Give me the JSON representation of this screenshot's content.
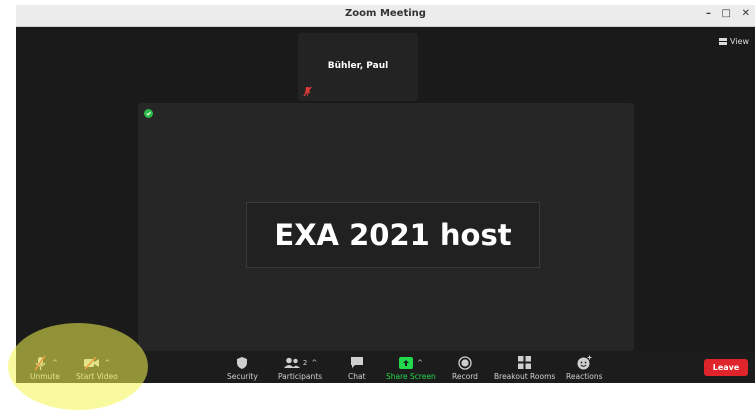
{
  "window": {
    "title": "Zoom Meeting",
    "minimize": "–",
    "maximize": "□",
    "close": "✕"
  },
  "view_button": {
    "label": "View"
  },
  "participant_tile": {
    "name": "Bühler, Paul"
  },
  "main_video": {
    "text": "EXA 2021 host"
  },
  "toolbar": {
    "unmute": "Unmute",
    "start_video": "Start Video",
    "security": "Security",
    "participants": "Participants",
    "participant_count": "2",
    "chat": "Chat",
    "share_screen": "Share Screen",
    "record": "Record",
    "breakout_rooms": "Breakout Rooms",
    "reactions": "Reactions",
    "leave": "Leave"
  },
  "colors": {
    "share_green": "#22d84c",
    "leave_red": "#e0242b",
    "muted_red": "#e23b3b",
    "highlight_yellow": "#f4f450"
  },
  "icons": [
    "microphone-muted-icon",
    "video-off-icon",
    "shield-icon",
    "participants-icon",
    "chat-bubble-icon",
    "share-screen-icon",
    "record-icon",
    "breakout-rooms-icon",
    "reactions-icon",
    "grid-view-icon"
  ]
}
